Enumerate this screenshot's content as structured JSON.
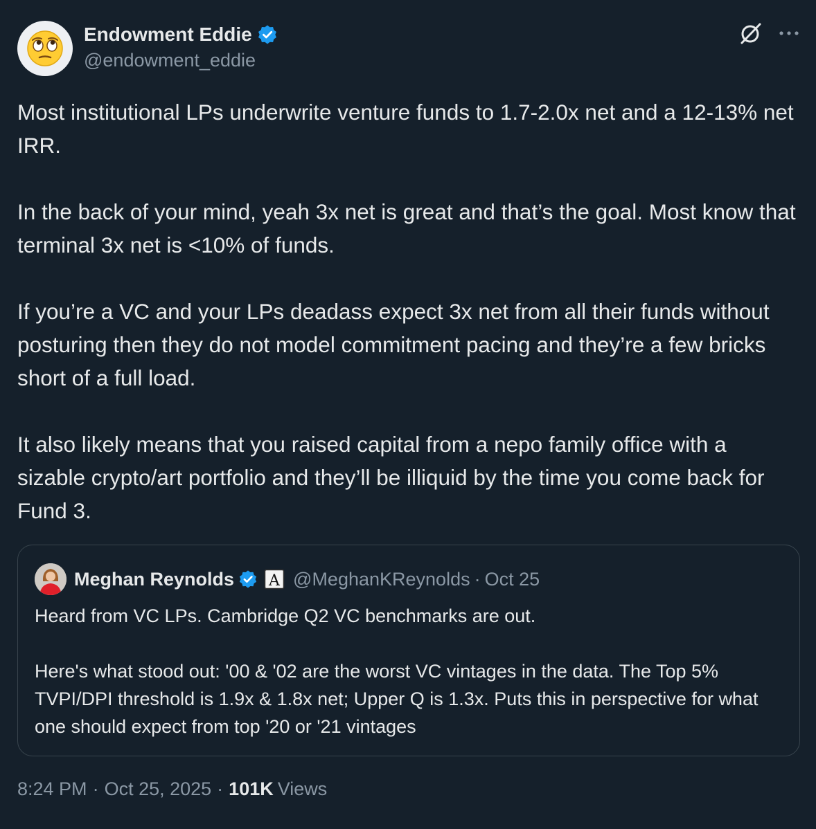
{
  "author": {
    "name": "Endowment Eddie",
    "handle": "@endowment_eddie",
    "avatar_icon": "face-with-rolling-eyes-icon",
    "verified_color": "#1d9bf0"
  },
  "actions": {
    "grok_icon": "grok-icon",
    "more_icon": "more-icon"
  },
  "body": {
    "p1": "Most institutional LPs underwrite venture funds to 1.7-2.0x net and a 12-13% net IRR.",
    "p2": "In the back of your mind, yeah 3x net is great and that’s the goal. Most know that terminal 3x net is <10% of funds.",
    "p3": "If you’re a VC and your LPs deadass expect 3x net from all their funds without posturing then they do not model commitment pacing and they’re a few bricks short of a full load.",
    "p4": "It also likely means that you raised capital from a nepo family office with a sizable crypto/art portfolio and they’ll be illiquid by the time you come back for Fund 3."
  },
  "quote": {
    "name": "Meghan Reynolds",
    "handle": "@MeghanKReynolds",
    "separator": "·",
    "date": "Oct 25",
    "affiliation_badge": "A",
    "p1": "Heard from VC LPs. Cambridge Q2 VC benchmarks are out.",
    "p2": "Here's what stood out:  '00 & '02 are the worst VC vintages in the data.  The Top 5% TVPI/DPI threshold is 1.9x & 1.8x net; Upper Q is 1.3x. Puts this in perspective for what one should expect from top '20 or '21 vintages"
  },
  "meta": {
    "time": "8:24 PM",
    "separator": "·",
    "date": "Oct 25, 2025",
    "views_count": "101K",
    "views_label": "Views"
  }
}
